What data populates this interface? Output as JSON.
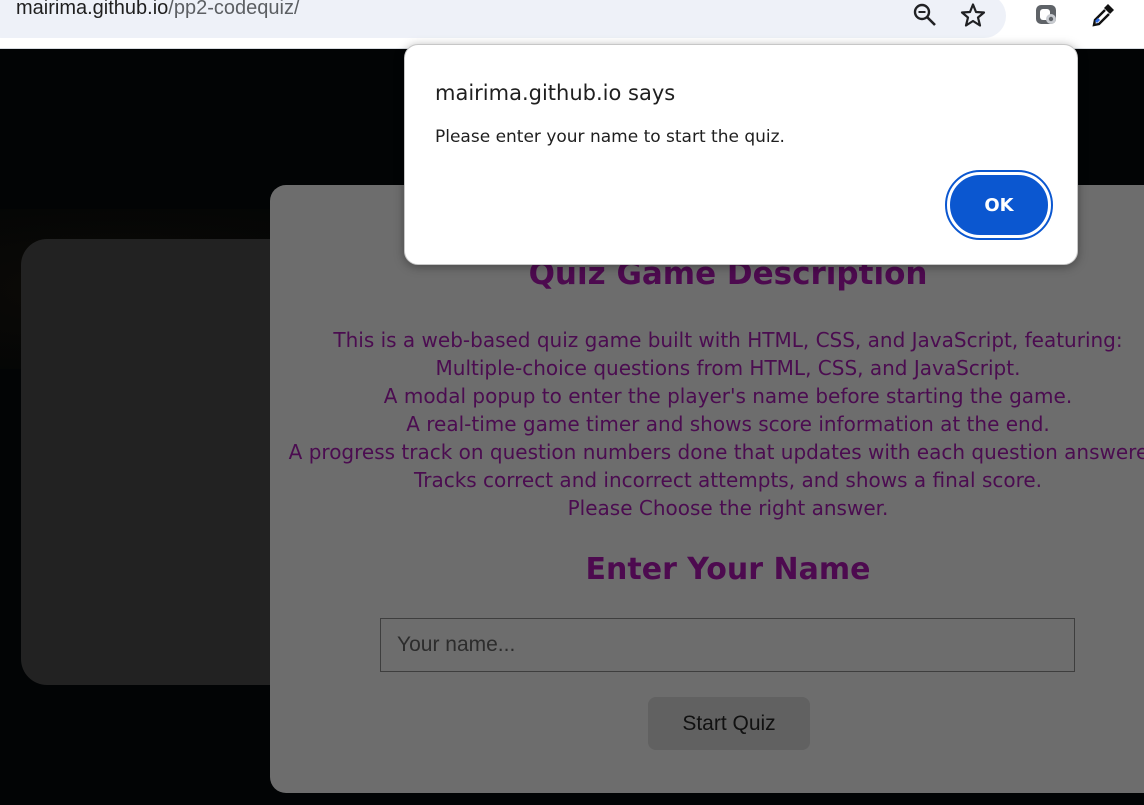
{
  "browser": {
    "url_domain": "mairima.github.io",
    "url_path": "/pp2-codequiz/",
    "icons": [
      "zoom-icon",
      "bookmark-star-icon",
      "extension-icon",
      "eyedropper-icon"
    ]
  },
  "dialog": {
    "title": "mairima.github.io says",
    "message": "Please enter your name to start the quiz.",
    "ok_label": "OK"
  },
  "quiz": {
    "description_title": "Quiz Game Description",
    "description_lines": [
      "This is a web-based quiz game built with HTML, CSS, and JavaScript, featuring:",
      "Multiple-choice questions from HTML, CSS, and JavaScript.",
      "A modal popup to enter the player's name before starting the game.",
      "A real-time game timer and shows score information at the end.",
      "A progress track on question numbers done that updates with each question answered.",
      "Tracks correct and incorrect attempts, and shows a final score.",
      "Please Choose the right answer."
    ],
    "name_title": "Enter Your Name",
    "name_placeholder": "Your name...",
    "start_label": "Start Quiz"
  },
  "colors": {
    "accent_purple": "#4d0a4f",
    "dialog_button_blue": "#0b57d0",
    "card_gray": "#6d6d6d"
  }
}
